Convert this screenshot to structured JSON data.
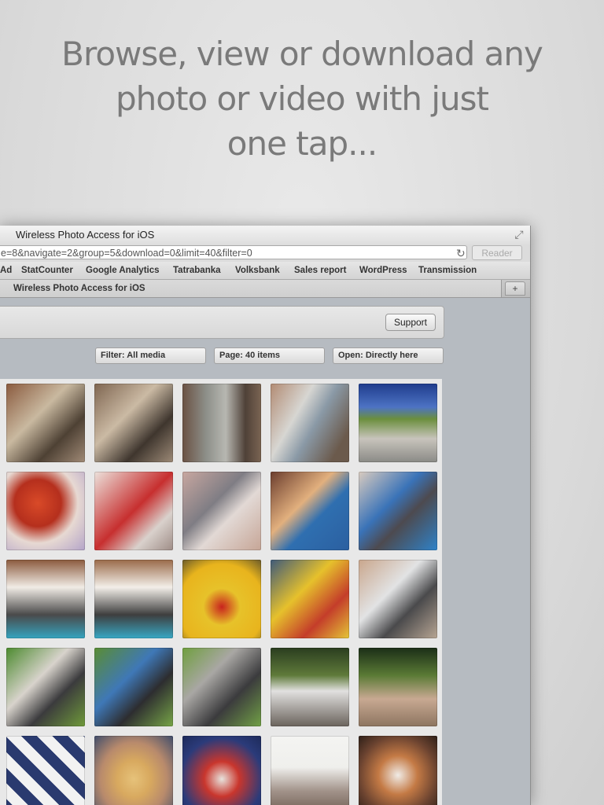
{
  "headline": {
    "line1": "Browse, view or download any",
    "line2": "photo or video with just",
    "line3": "one tap..."
  },
  "browser": {
    "window_title": "Wireless Photo Access for iOS",
    "url": "e=8&navigate=2&group=5&download=0&limit=40&filter=0",
    "reader_label": "Reader",
    "bookmarks": [
      "Ad",
      "StatCounter",
      "Google Analytics",
      "Tatrabanka",
      "Volksbank",
      "Sales report",
      "WordPress",
      "Transmission"
    ],
    "tab_title": "Wireless Photo Access for iOS",
    "newtab_label": "+",
    "reload_icon": "reload-icon",
    "fullscreen_icon": "fullscreen-icon"
  },
  "page": {
    "support_label": "Support",
    "filters": [
      {
        "label": "Filter: All media"
      },
      {
        "label": "Page: 40 items"
      },
      {
        "label": "Open: Directly here"
      }
    ]
  },
  "colors": {
    "headline": "#7a7a7a",
    "content_bg": "#b6bbc1"
  }
}
